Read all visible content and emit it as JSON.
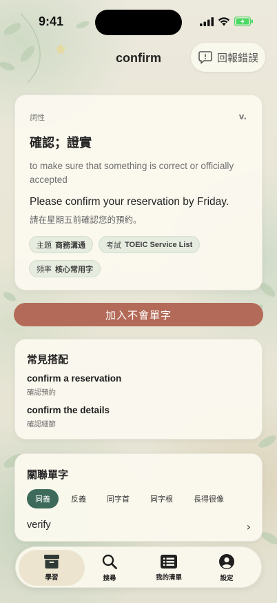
{
  "status_bar": {
    "time": "9:41"
  },
  "header": {
    "title": "confirm",
    "report_label": "回報錯誤"
  },
  "word_card": {
    "pos_label": "詞性",
    "pos_value": "v.",
    "definition_zh": "確認；證實",
    "definition_en": "to make sure that something is correct or officially accepted",
    "example_en": "Please confirm your reservation by Friday.",
    "example_zh": "請在星期五前確認您的預約。",
    "tags": [
      {
        "label": "主題",
        "value": "商務溝通"
      },
      {
        "label": "考試",
        "value": "TOEIC Service List"
      },
      {
        "label": "頻率",
        "value": "核心常用字"
      }
    ]
  },
  "add_button_label": "加入不會單字",
  "collocations": {
    "title": "常見搭配",
    "items": [
      {
        "phrase": "confirm a reservation",
        "meaning": "確認預約"
      },
      {
        "phrase": "confirm the details",
        "meaning": "確認細節"
      }
    ]
  },
  "related": {
    "title": "關聯單字",
    "tabs": [
      "同義",
      "反義",
      "同字首",
      "同字根",
      "長得很像"
    ],
    "active_tab": "同義",
    "word": "verify"
  },
  "tab_bar": {
    "items": [
      {
        "label": "學習",
        "icon": "archive-box-icon"
      },
      {
        "label": "搜尋",
        "icon": "magnifier-icon"
      },
      {
        "label": "我的清單",
        "icon": "list-icon"
      },
      {
        "label": "設定",
        "icon": "person-icon"
      }
    ],
    "active": "學習"
  },
  "colors": {
    "accent": "#b46a58",
    "active_tab": "#3d6a5a",
    "card_bg": "#fbf9ee",
    "battery": "#4cd964"
  }
}
